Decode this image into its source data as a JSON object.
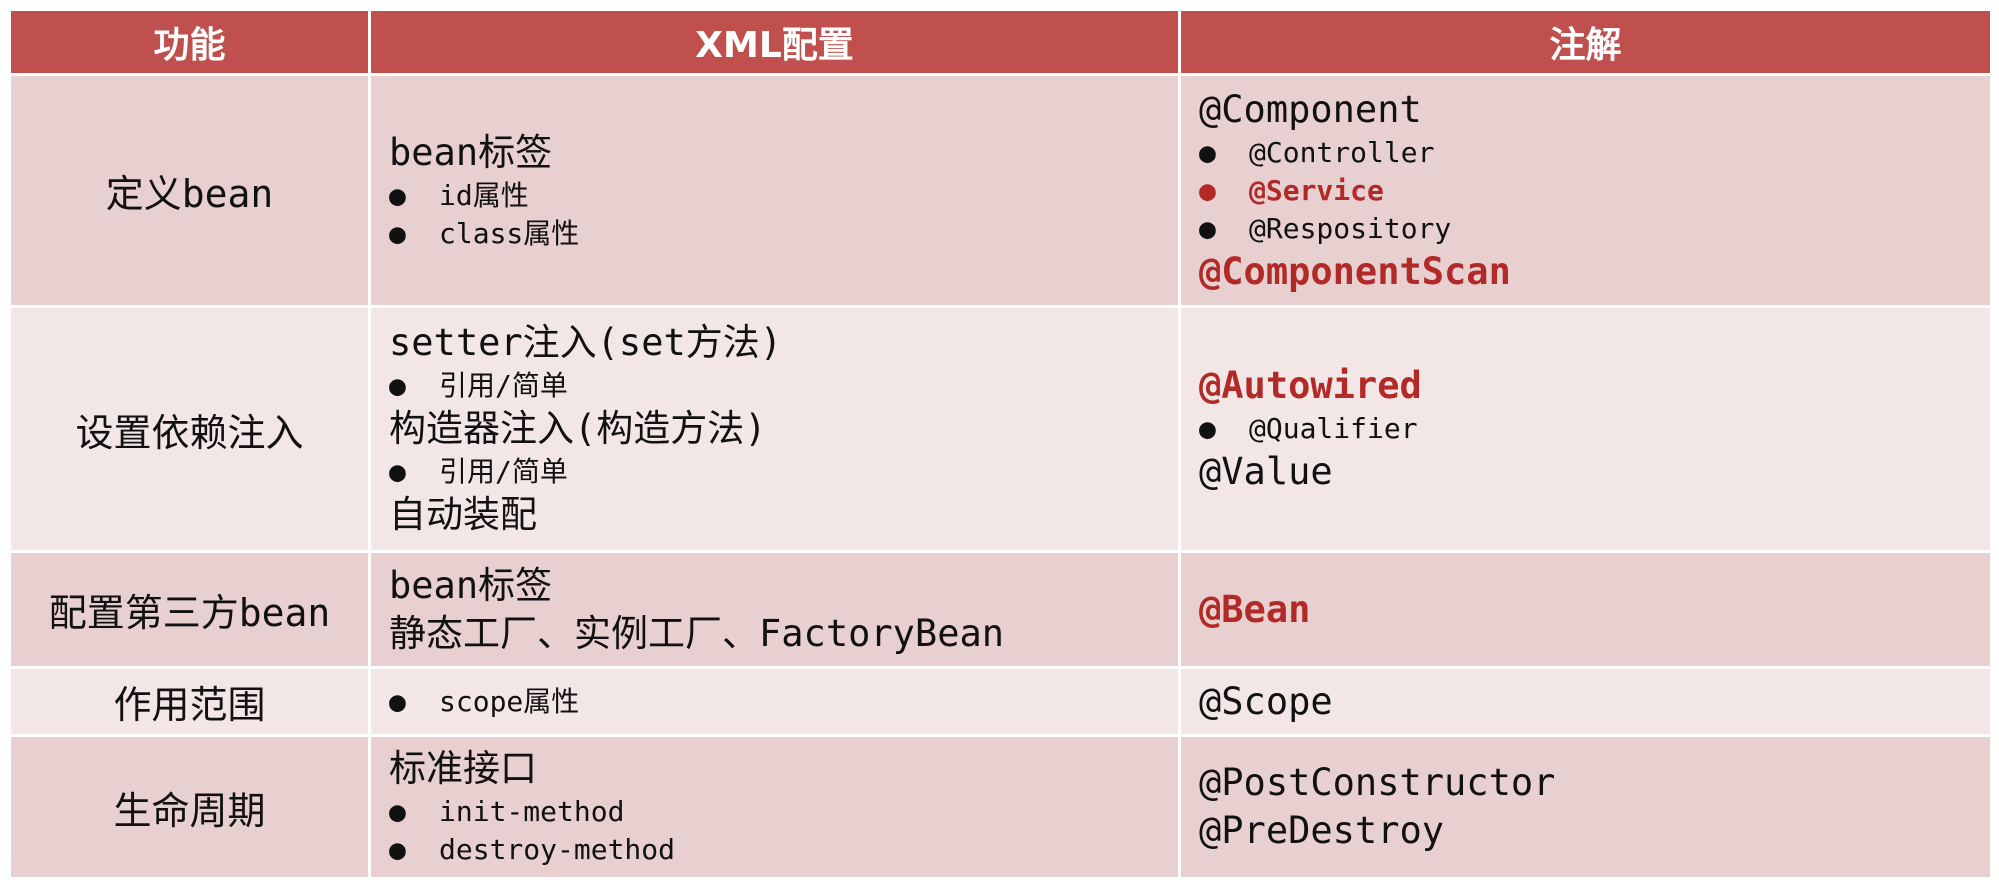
{
  "headers": {
    "feature": "功能",
    "xml": "XML配置",
    "annotation": "注解"
  },
  "colors": {
    "header_bg": "#c0504d",
    "row_dark": "#e8cfd0",
    "row_light": "#f3e6e6",
    "highlight": "#b22a27"
  },
  "bullet": "●",
  "rows": [
    {
      "feature": "定义bean",
      "xml": {
        "title": "bean标签",
        "items": [
          "id属性",
          "class属性"
        ]
      },
      "annotation": {
        "title": "@Component",
        "items": [
          "@Controller",
          "@Service",
          "@Respository"
        ],
        "extra": "@ComponentScan"
      }
    },
    {
      "feature": "设置依赖注入",
      "xml": {
        "line1": "setter注入(set方法)",
        "item1": "引用/简单",
        "line2": "构造器注入(构造方法)",
        "item2": "引用/简单",
        "line3": "自动装配"
      },
      "annotation": {
        "title": "@Autowired",
        "item": "@Qualifier",
        "extra": "@Value"
      }
    },
    {
      "feature": "配置第三方bean",
      "xml": {
        "line1": "bean标签",
        "line2": "静态工厂、实例工厂、FactoryBean"
      },
      "annotation": {
        "title": "@Bean"
      }
    },
    {
      "feature": "作用范围",
      "xml": {
        "item": "scope属性"
      },
      "annotation": {
        "title": "@Scope"
      }
    },
    {
      "feature": "生命周期",
      "xml": {
        "title": "标准接口",
        "items": [
          "init-method",
          "destroy-method"
        ]
      },
      "annotation": {
        "line1": "@PostConstructor",
        "line2": "@PreDestroy"
      }
    }
  ]
}
